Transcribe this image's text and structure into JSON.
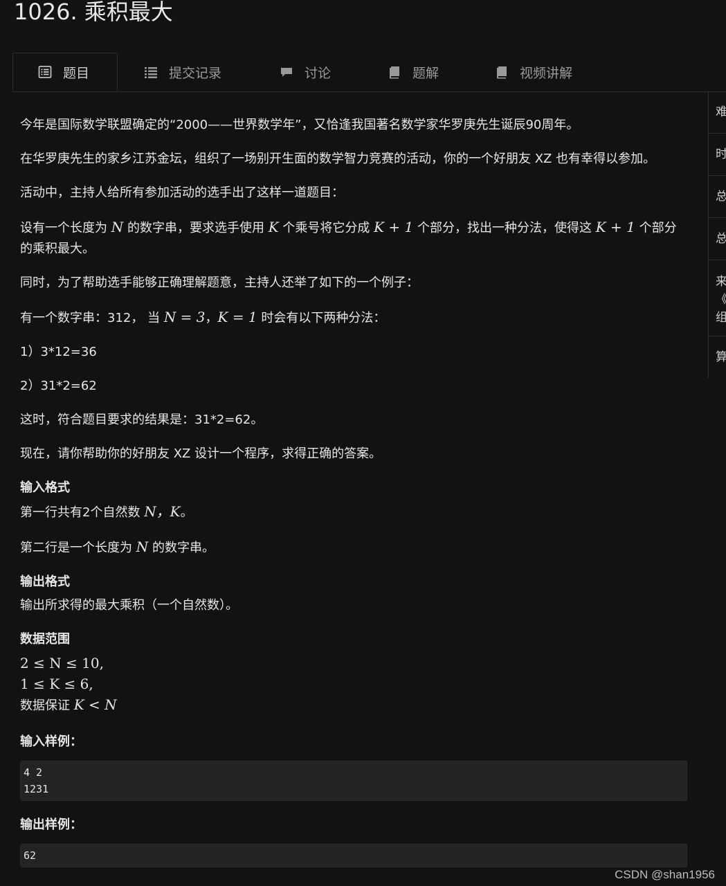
{
  "title": "1026. 乘积最大",
  "tabs": [
    {
      "label": "题目",
      "icon": "list-alt-icon",
      "active": true
    },
    {
      "label": "提交记录",
      "icon": "list-icon",
      "active": false
    },
    {
      "label": "讨论",
      "icon": "comment-icon",
      "active": false
    },
    {
      "label": "题解",
      "icon": "book-icon",
      "active": false
    },
    {
      "label": "视频讲解",
      "icon": "book-icon",
      "active": false
    }
  ],
  "side_panel": {
    "cells": [
      "难",
      "时",
      "总",
      "总",
      "来",
      "《",
      "组",
      "算"
    ]
  },
  "problem": {
    "p1": "今年是国际数学联盟确定的“2000——世界数学年”，又恰逢我国著名数学家华罗庚先生诞辰90周年。",
    "p2": "在华罗庚先生的家乡江苏金坛，组织了一场别开生面的数学智力竞赛的活动，你的一个好朋友 XZ 也有幸得以参加。",
    "p3": "活动中，主持人给所有参加活动的选手出了这样一道题目：",
    "p4_a": "设有一个长度为",
    "p4_n": "N",
    "p4_b": "的数字串，要求选手使用",
    "p4_k": "K",
    "p4_c": "个乘号将它分成",
    "p4_k1": "K + 1",
    "p4_d": "个部分，找出一种分法，使得这",
    "p4_k2": "K + 1",
    "p4_e": "个部分的乘积最大。",
    "p5": "同时，为了帮助选手能够正确理解题意，主持人还举了如下的一个例子：",
    "p6_a": "有一个数字串：312， 当",
    "p6_n": "N = 3",
    "p6_sep": "，",
    "p6_k": "K = 1",
    "p6_b": "时会有以下两种分法：",
    "p7": "1）3*12=36",
    "p8": "2）31*2=62",
    "p9": "这时，符合题目要求的结果是：31*2=62。",
    "p10": "现在，请你帮助你的好朋友 XZ 设计一个程序，求得正确的答案。"
  },
  "input_format": {
    "heading": "输入格式",
    "line1_a": "第一行共有2个自然数",
    "line1_m": "N，K",
    "line1_b": "。",
    "line2_a": "第二行是一个长度为",
    "line2_m": "N",
    "line2_b": "的数字串。"
  },
  "output_format": {
    "heading": "输出格式",
    "line1": "输出所求得的最大乘积（一个自然数）。"
  },
  "range": {
    "heading": "数据范围",
    "r1": "2 ≤ N ≤ 10,",
    "r2": "1 ≤ K ≤ 6,",
    "r3_a": "数据保证",
    "r3_m": "K < N"
  },
  "sample_input": {
    "heading": "输入样例：",
    "lines": [
      "4 2",
      "1231"
    ]
  },
  "sample_output": {
    "heading": "输出样例：",
    "lines": [
      "62"
    ]
  },
  "watermark": "CSDN @shan1956"
}
